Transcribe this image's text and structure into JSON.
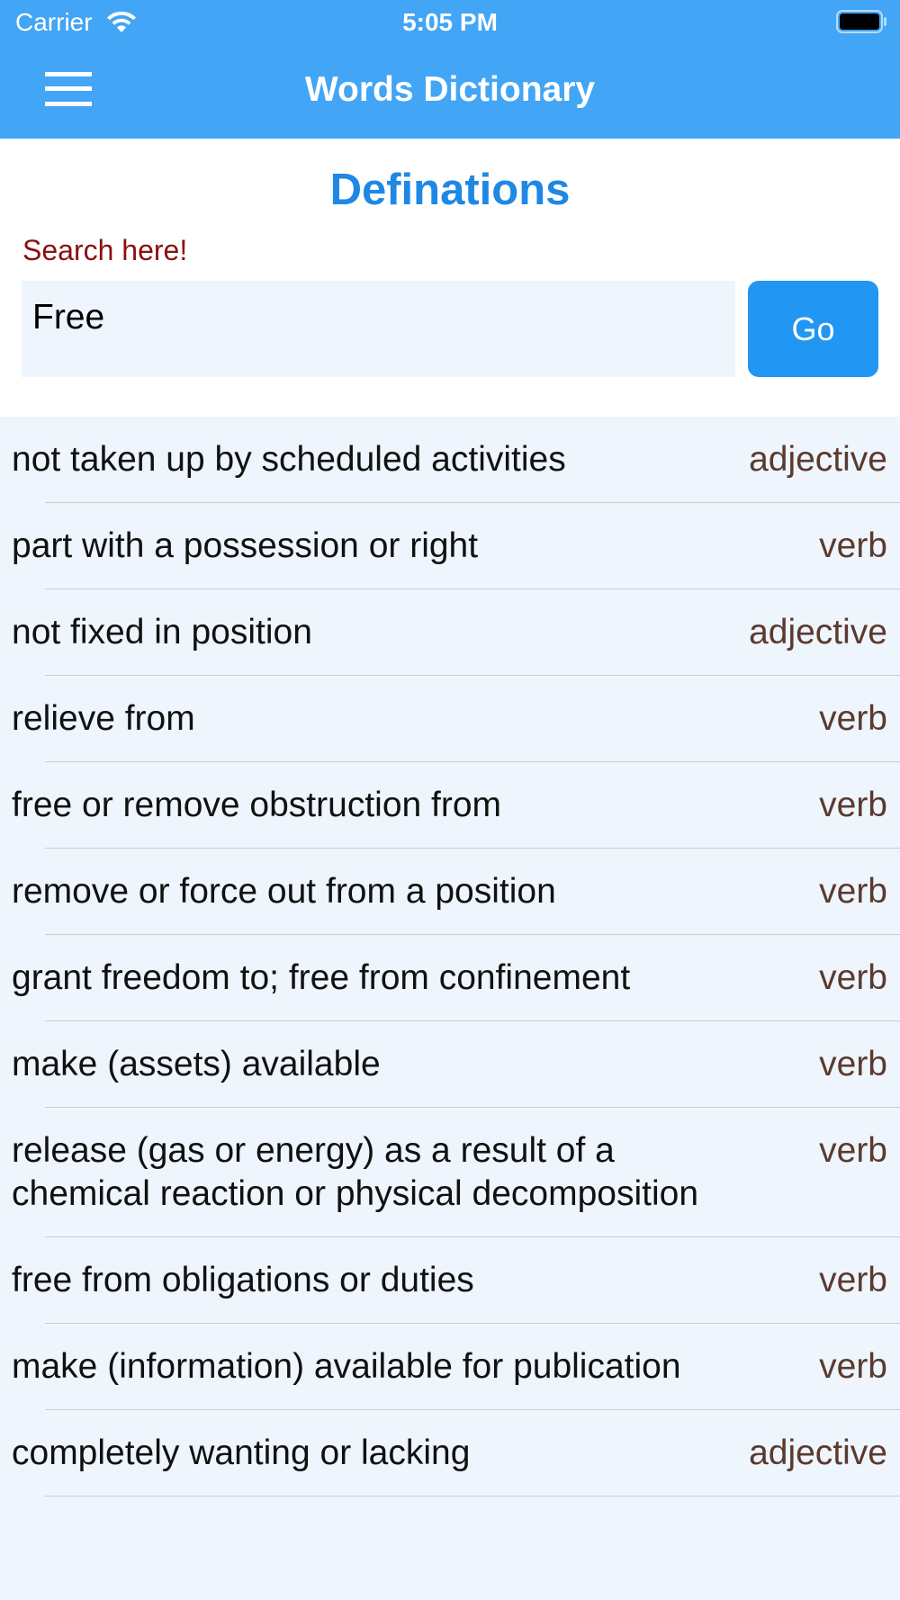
{
  "status_bar": {
    "carrier": "Carrier",
    "time": "5:05 PM"
  },
  "nav": {
    "title": "Words Dictionary",
    "menu_icon": "hamburger-menu-icon"
  },
  "page": {
    "heading": "Definations"
  },
  "search": {
    "label": "Search here!",
    "value": "Free",
    "button_label": "Go"
  },
  "colors": {
    "header": "#42a5f5",
    "accent": "#1e88e5",
    "button": "#2196f3",
    "search_label": "#8b1010",
    "part_of_speech": "#5b3a2e",
    "list_background": "#eef5fd"
  },
  "definitions": [
    {
      "text": "not taken up by scheduled activities",
      "pos": "adjective"
    },
    {
      "text": "part with a possession or right",
      "pos": "verb"
    },
    {
      "text": "not fixed in position",
      "pos": "adjective"
    },
    {
      "text": "relieve from",
      "pos": "verb"
    },
    {
      "text": "free or remove obstruction from",
      "pos": "verb"
    },
    {
      "text": "remove or force out from a position",
      "pos": "verb"
    },
    {
      "text": "grant freedom to; free from confinement",
      "pos": "verb"
    },
    {
      "text": "make (assets) available",
      "pos": "verb"
    },
    {
      "text": "release (gas or energy) as a result of a chemical reaction or physical decomposition",
      "pos": "verb"
    },
    {
      "text": "free from obligations or duties",
      "pos": "verb"
    },
    {
      "text": "make (information) available for publication",
      "pos": "verb"
    },
    {
      "text": "completely wanting or lacking",
      "pos": "adjective"
    }
  ]
}
